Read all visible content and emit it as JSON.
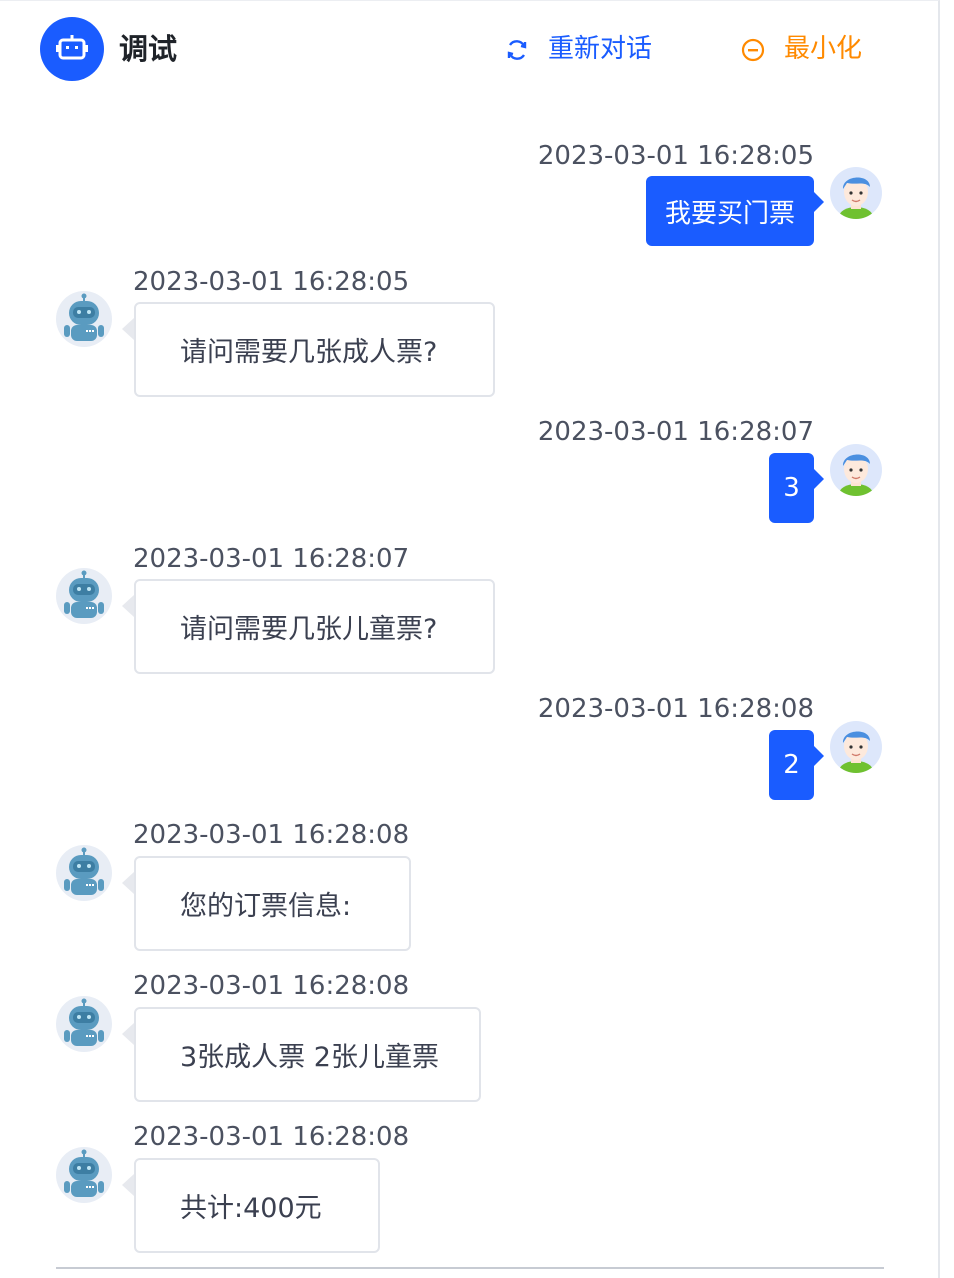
{
  "header": {
    "title": "调试",
    "restart_label": "重新对话",
    "minimize_label": "最小化"
  },
  "colors": {
    "accent": "#1a5cff",
    "minimize": "#ff8a00",
    "bot_avatar": "#5a9bc0",
    "user_shirt": "#6fc130"
  },
  "messages": [
    {
      "role": "user",
      "time": "2023-03-01 16:28:05",
      "text": "我要买门票"
    },
    {
      "role": "bot",
      "time": "2023-03-01 16:28:05",
      "text": "请问需要几张成人票?"
    },
    {
      "role": "user",
      "time": "2023-03-01 16:28:07",
      "text": "3"
    },
    {
      "role": "bot",
      "time": "2023-03-01 16:28:07",
      "text": "请问需要几张儿童票?"
    },
    {
      "role": "user",
      "time": "2023-03-01 16:28:08",
      "text": "2"
    },
    {
      "role": "bot",
      "time": "2023-03-01 16:28:08",
      "text": "您的订票信息:"
    },
    {
      "role": "bot",
      "time": "2023-03-01 16:28:08",
      "text": "3张成人票 2张儿童票"
    },
    {
      "role": "bot",
      "time": "2023-03-01 16:28:08",
      "text": "共计:400元"
    }
  ]
}
